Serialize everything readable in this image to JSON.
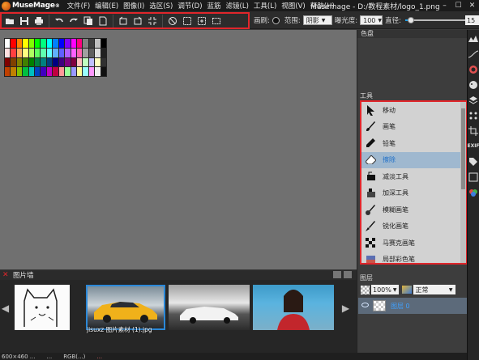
{
  "app": {
    "logo_text": "MuseMage",
    "logo_reg": "®",
    "window_title": "Musemage - D:/教程素材/logo_1.png"
  },
  "menu": [
    "文件(F)",
    "编辑(E)",
    "图像(I)",
    "选区(S)",
    "调节(D)",
    "蓝筋",
    "滤镜(L)",
    "工具(L)",
    "视图(V)",
    "帮助(H)"
  ],
  "window_controls": {
    "minimize": "–",
    "maximize": "☐",
    "close": "✕"
  },
  "brush_options": {
    "brush_label": "画刷:",
    "range_label": "范围:",
    "range_value": "阴影",
    "exposure_label": "曝光度:",
    "exposure_value": "100",
    "diameter_label": "直径:",
    "diameter_value": "15",
    "diameter_fraction": 0.08
  },
  "panels": {
    "swatches_title": "色盘",
    "tools_title": "工具",
    "layers_title": "图层",
    "filmstrip_title": "图片墙"
  },
  "tools": [
    {
      "label": "移动",
      "icon": "move-arrow-icon"
    },
    {
      "label": "画笔",
      "icon": "paintbrush-icon"
    },
    {
      "label": "铅笔",
      "icon": "pencil-icon"
    },
    {
      "label": "擦除",
      "icon": "eraser-icon",
      "active": true
    },
    {
      "label": "减淡工具",
      "icon": "dodge-icon"
    },
    {
      "label": "加深工具",
      "icon": "burn-icon"
    },
    {
      "label": "模糊画笔",
      "icon": "blur-brush-icon"
    },
    {
      "label": "锐化画笔",
      "icon": "sharpen-brush-icon"
    },
    {
      "label": "马赛克画笔",
      "icon": "mosaic-brush-icon"
    },
    {
      "label": "局部彩色笔",
      "icon": "local-color-brush-icon"
    }
  ],
  "layers": {
    "opacity": "100%",
    "blend_mode": "正常",
    "layer_name": "图层 0"
  },
  "filmstrip": {
    "caption": "jisuxz 图片素材 (1).jpg"
  },
  "status": {
    "left": "600×460 ...",
    "middle": "...",
    "rgb": "RGB(...)",
    "right": "..."
  },
  "colors": {
    "accent_red": "#e0262b",
    "selection_blue": "#2b88d8"
  },
  "swatch_colors": [
    "#ffffff",
    "#ff0000",
    "#ff8000",
    "#ffff00",
    "#80ff00",
    "#00ff00",
    "#00ff80",
    "#00ffff",
    "#0080ff",
    "#0000ff",
    "#8000ff",
    "#ff00ff",
    "#ff0080",
    "#808080",
    "#404040",
    "#c0c0c0",
    "#000000",
    "#ffe0e0",
    "#ff4040",
    "#ffb060",
    "#ffff80",
    "#b0ff60",
    "#60ff60",
    "#60ffb0",
    "#60ffff",
    "#60b0ff",
    "#6060ff",
    "#b060ff",
    "#ff60ff",
    "#ff60b0",
    "#a0a0a0",
    "#606060",
    "#e0e0e0",
    "#202020",
    "#800000",
    "#804000",
    "#808000",
    "#408000",
    "#008000",
    "#008040",
    "#008080",
    "#004080",
    "#000080",
    "#400080",
    "#800080",
    "#800040",
    "#ffc0c0",
    "#c0ffc0",
    "#c0c0ff",
    "#ffffc0",
    "#303030",
    "#c04000",
    "#c08000",
    "#80c000",
    "#00c040",
    "#00c0c0",
    "#0040c0",
    "#4000c0",
    "#c000c0",
    "#c00040",
    "#ff9999",
    "#99ff99",
    "#9999ff",
    "#ffff99",
    "#99ffff",
    "#ff99ff",
    "#f0f0f0",
    "#101010"
  ]
}
